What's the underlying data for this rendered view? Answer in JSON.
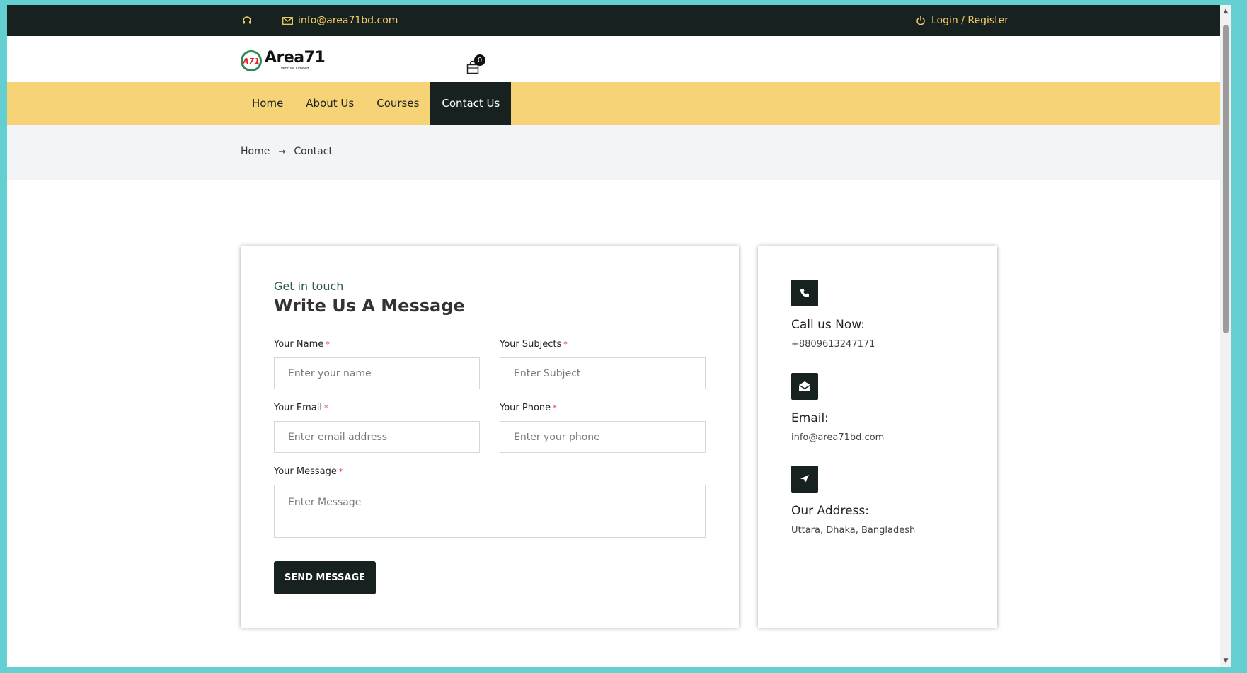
{
  "topbar": {
    "email": "info@area71bd.com",
    "login": "Login",
    "slash": " / ",
    "register": "Register"
  },
  "header": {
    "logo_name": "Area71",
    "logo_badge": "A71",
    "logo_tagline": "Venture Limited",
    "cart_count": "0"
  },
  "nav": {
    "items": [
      {
        "label": "Home"
      },
      {
        "label": "About Us"
      },
      {
        "label": "Courses"
      },
      {
        "label": "Contact Us"
      }
    ]
  },
  "breadcrumb": {
    "home": "Home",
    "current": "Contact"
  },
  "form": {
    "kicker": "Get in touch",
    "title": "Write Us A Message",
    "required_mark": "*",
    "name_label": "Your Name",
    "name_placeholder": "Enter your name",
    "subject_label": "Your Subjects",
    "subject_placeholder": "Enter Subject",
    "email_label": "Your Email",
    "email_placeholder": "Enter email address",
    "phone_label": "Your Phone",
    "phone_placeholder": "Enter your phone",
    "message_label": "Your Message",
    "message_placeholder": "Enter Message",
    "submit_label": "SEND MESSAGE"
  },
  "contact_info": {
    "call_title": "Call us Now:",
    "call_value": "+8809613247171",
    "email_title": "Email:",
    "email_value": "info@area71bd.com",
    "address_title": "Our Address:",
    "address_value": "Uttara, Dhaka, Bangladesh"
  },
  "colors": {
    "dark": "#172220",
    "accent_yellow": "#f5d376",
    "top_text": "#f4ce66",
    "required": "#e53935"
  }
}
